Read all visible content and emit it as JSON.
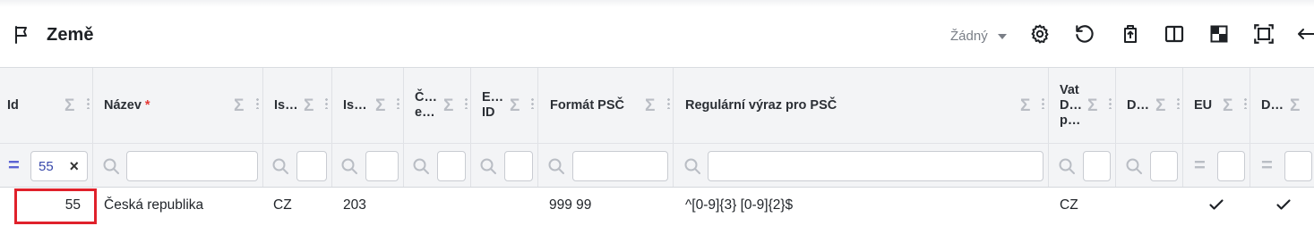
{
  "toolbar": {
    "title": "Země",
    "preset_value": "Žádný",
    "icons": [
      "flag-icon",
      "settings-icon",
      "reset-icon",
      "export-icon",
      "columns-icon",
      "layout-icon",
      "fullscreen-icon",
      "expand-icon"
    ]
  },
  "columns": [
    {
      "label": "Id",
      "required": false
    },
    {
      "label": "Název",
      "required": true,
      "required_mark": "*"
    },
    {
      "label": "Is…"
    },
    {
      "label": "Is…"
    },
    {
      "label": "Č… e…"
    },
    {
      "label": "E… ID"
    },
    {
      "label": "Formát PSČ"
    },
    {
      "label": "Regulární výraz pro PSČ"
    },
    {
      "label": "Vat D… p…"
    },
    {
      "label": "D…"
    },
    {
      "label": "EU"
    },
    {
      "label": "D…"
    }
  ],
  "header_icons": {
    "sum": "Σ"
  },
  "filters": {
    "id_value": "55",
    "id_operator": "=",
    "clear": "×",
    "eq_operator": "="
  },
  "rows": [
    {
      "id": "55",
      "name": "Česká republika",
      "iso2": "CZ",
      "iso_num": "203",
      "col5": "",
      "col6": "",
      "postal_format": "999 99",
      "postal_regex": "^[0-9]{3} [0-9]{2}$",
      "vat": "CZ",
      "col10": "",
      "eu": true,
      "last": true
    }
  ],
  "colors": {
    "accent": "#5b63d3",
    "highlight": "#e0212b",
    "required": "#e53935"
  }
}
